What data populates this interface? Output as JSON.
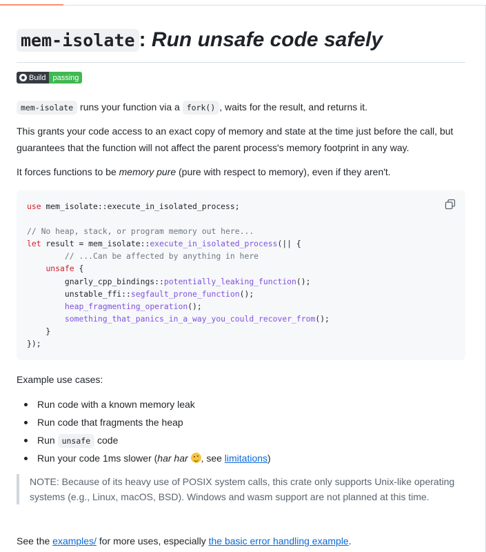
{
  "title": {
    "code": "mem-isolate",
    "separator": ":",
    "tagline": "Run unsafe code safely"
  },
  "badge": {
    "icon": "github-icon",
    "left": "Build",
    "right": "passing"
  },
  "intro": {
    "code1": "mem-isolate",
    "text1": " runs your function via a ",
    "code2": "fork()",
    "text2": ", waits for the result, and returns it."
  },
  "paragraph2": "This grants your code access to an exact copy of memory and state at the time just before the call, but guarantees that the function will not affect the parent process's memory footprint in any way.",
  "paragraph3": {
    "before": "It forces functions to be ",
    "em": "memory pure",
    "after": " (pure with respect to memory), even if they aren't."
  },
  "code": {
    "copy_icon": "copy-icon",
    "lines": [
      "use mem_isolate::execute_in_isolated_process;",
      "",
      "// No heap, stack, or program memory out here...",
      "let result = mem_isolate::execute_in_isolated_process(|| {",
      "    // ...Can be affected by anything in here",
      "    unsafe {",
      "        gnarly_cpp_bindings::potentially_leaking_function();",
      "        unstable_ffi::segfault_prone_function();",
      "        heap_fragmenting_operation();",
      "        something_that_panics_in_a_way_you_could_recover_from();",
      "    }",
      "});"
    ]
  },
  "use_cases": {
    "heading": "Example use cases:",
    "item1": "Run code with a known memory leak",
    "item2": "Run code that fragments the heap",
    "item3_before": "Run ",
    "item3_code": "unsafe",
    "item3_after": " code",
    "item4_before": "Run your code 1ms slower (",
    "item4_em": "har har",
    "item4_mid": ", see ",
    "item4_link": "limitations",
    "item4_after": ")"
  },
  "note": "NOTE: Because of its heavy use of POSIX system calls, this crate only supports Unix-like operating systems (e.g., Linux, macOS, BSD). Windows and wasm support are not planned at this time.",
  "footer": {
    "before": "See the ",
    "link1": "examples/",
    "mid": " for more uses, especially ",
    "link2": "the basic error handling example",
    "after": "."
  }
}
